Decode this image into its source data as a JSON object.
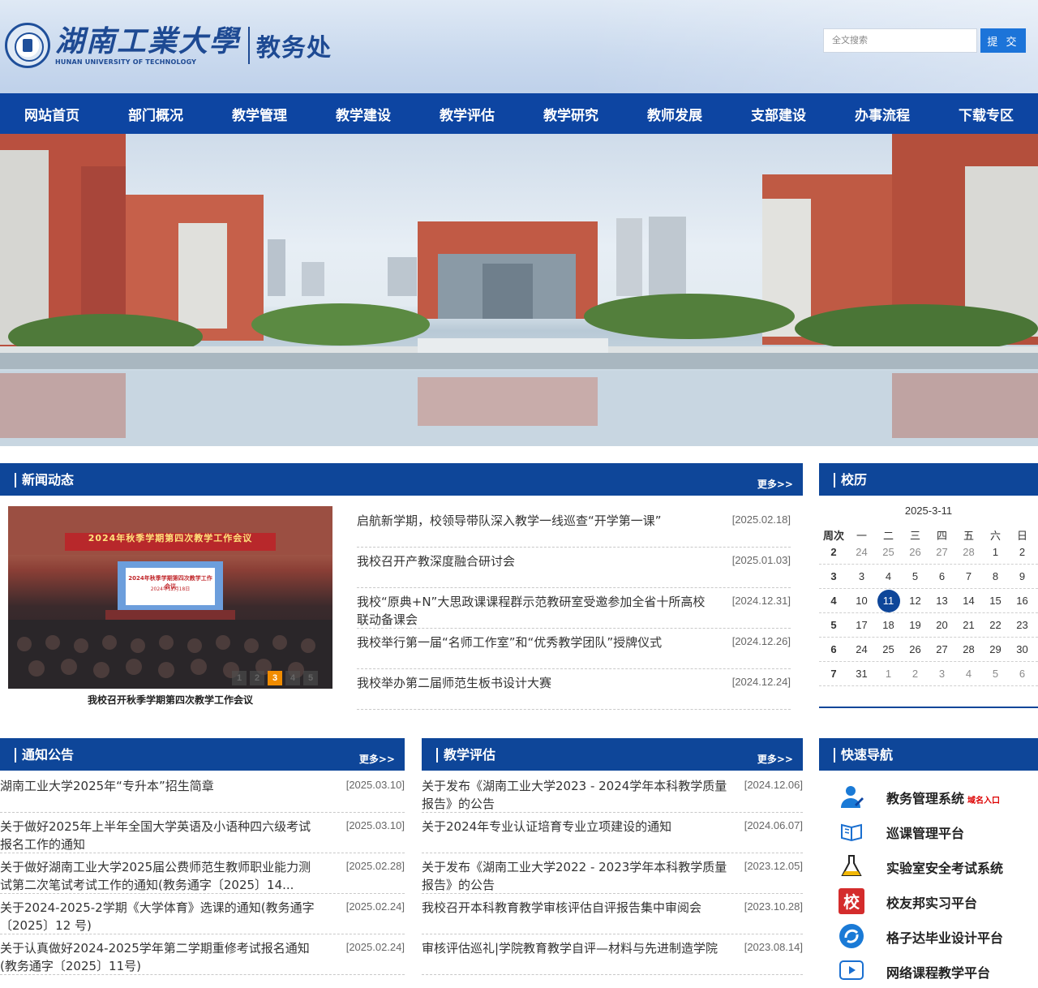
{
  "header": {
    "logo_cn": "湖南工業大學",
    "logo_en": "HUNAN UNIVERSITY OF TECHNOLOGY",
    "dept": "教务处",
    "search_placeholder": "全文搜索",
    "submit_label": "提 交"
  },
  "nav": [
    "网站首页",
    "部门概况",
    "教学管理",
    "教学建设",
    "教学评估",
    "教学研究",
    "教师发展",
    "支部建设",
    "办事流程",
    "下载专区"
  ],
  "news": {
    "title": "新闻动态",
    "more": "更多>>",
    "photo": {
      "banner_line1": "2024年秋季学期第四次教学工作会议",
      "screen_text": "2024年秋季学期第四次教学工作会议",
      "screen_date": "2024年12月18日",
      "pager": [
        "1",
        "2",
        "3",
        "4",
        "5"
      ],
      "active_page": "3",
      "caption": "我校召开秋季学期第四次教学工作会议"
    },
    "items": [
      {
        "title": "启航新学期，校领导带队深入教学一线巡查“开学第一课”",
        "date": "[2025.02.18]"
      },
      {
        "title": "我校召开产教深度融合研讨会",
        "date": "[2025.01.03]"
      },
      {
        "title": "我校“原典+N”大思政课课程群示范教研室受邀参加全省十所高校联动备课会",
        "date": "[2024.12.31]"
      },
      {
        "title": "我校举行第一届“名师工作室”和“优秀教学团队”授牌仪式",
        "date": "[2024.12.26]"
      },
      {
        "title": "我校举办第二届师范生板书设计大赛",
        "date": "[2024.12.24]"
      }
    ]
  },
  "calendar": {
    "title": "校历",
    "date": "2025-3-11",
    "headers": [
      "周次",
      "一",
      "二",
      "三",
      "四",
      "五",
      "六",
      "日"
    ],
    "rows": [
      {
        "week": "2",
        "days": [
          "24",
          "25",
          "26",
          "27",
          "28",
          "1",
          "2"
        ],
        "dim": [
          true,
          true,
          true,
          true,
          true,
          false,
          false
        ]
      },
      {
        "week": "3",
        "days": [
          "3",
          "4",
          "5",
          "6",
          "7",
          "8",
          "9"
        ],
        "dim": [
          false,
          false,
          false,
          false,
          false,
          false,
          false
        ]
      },
      {
        "week": "4",
        "days": [
          "10",
          "11",
          "12",
          "13",
          "14",
          "15",
          "16"
        ],
        "dim": [
          false,
          false,
          false,
          false,
          false,
          false,
          false
        ]
      },
      {
        "week": "5",
        "days": [
          "17",
          "18",
          "19",
          "20",
          "21",
          "22",
          "23"
        ],
        "dim": [
          false,
          false,
          false,
          false,
          false,
          false,
          false
        ]
      },
      {
        "week": "6",
        "days": [
          "24",
          "25",
          "26",
          "27",
          "28",
          "29",
          "30"
        ],
        "dim": [
          false,
          false,
          false,
          false,
          false,
          false,
          false
        ]
      },
      {
        "week": "7",
        "days": [
          "31",
          "1",
          "2",
          "3",
          "4",
          "5",
          "6"
        ],
        "dim": [
          false,
          true,
          true,
          true,
          true,
          true,
          true
        ]
      }
    ],
    "today": "11"
  },
  "notices": {
    "title": "通知公告",
    "more": "更多>>",
    "items": [
      {
        "title": "湖南工业大学2025年“专升本”招生简章",
        "date": "[2025.03.10]"
      },
      {
        "title": "关于做好2025年上半年全国大学英语及小语种四六级考试报名工作的通知",
        "date": "[2025.03.10]"
      },
      {
        "title": "关于做好湖南工业大学2025届公费师范生教师职业能力测试第二次笔试考试工作的通知(教务通字〔2025〕14...",
        "date": "[2025.02.28]"
      },
      {
        "title": "关于2024-2025-2学期《大学体育》选课的通知(教务通字〔2025〕12 号)",
        "date": "[2025.02.24]"
      },
      {
        "title": "关于认真做好2024-2025学年第二学期重修考试报名通知(教务通字〔2025〕11号)",
        "date": "[2025.02.24]"
      }
    ]
  },
  "evaluation": {
    "title": "教学评估",
    "more": "更多>>",
    "items": [
      {
        "title": "关于发布《湖南工业大学2023 - 2024学年本科教学质量报告》的公告",
        "date": "[2024.12.06]"
      },
      {
        "title": "关于2024年专业认证培育专业立项建设的通知",
        "date": "[2024.06.07]"
      },
      {
        "title": "关于发布《湖南工业大学2022 - 2023学年本科教学质量报告》的公告",
        "date": "[2023.12.05]"
      },
      {
        "title": "我校召开本科教育教学审核评估自评报告集中审阅会",
        "date": "[2023.10.28]"
      },
      {
        "title": "审核评估巡礼|学院教育教学自评—材料与先进制造学院",
        "date": "[2023.08.14]"
      }
    ]
  },
  "quicknav": {
    "title": "快速导航",
    "items": [
      {
        "label": "教务管理系统",
        "tag": "域名入口",
        "icon": "user-pen-icon"
      },
      {
        "label": "巡课管理平台",
        "tag": "",
        "icon": "book-icon"
      },
      {
        "label": "实验室安全考试系统",
        "tag": "",
        "icon": "flask-icon"
      },
      {
        "label": "校友邦实习平台",
        "tag": "",
        "icon": "school-badge-icon"
      },
      {
        "label": "格子达毕业设计平台",
        "tag": "",
        "icon": "swirl-icon"
      },
      {
        "label": "网络课程教学平台",
        "tag": "",
        "icon": "play-icon"
      }
    ]
  },
  "colors": {
    "nav": "#0d45a2",
    "panel_head": "#0e4699",
    "search_button": "#1c74d9",
    "pager_active": "#f08c00"
  }
}
